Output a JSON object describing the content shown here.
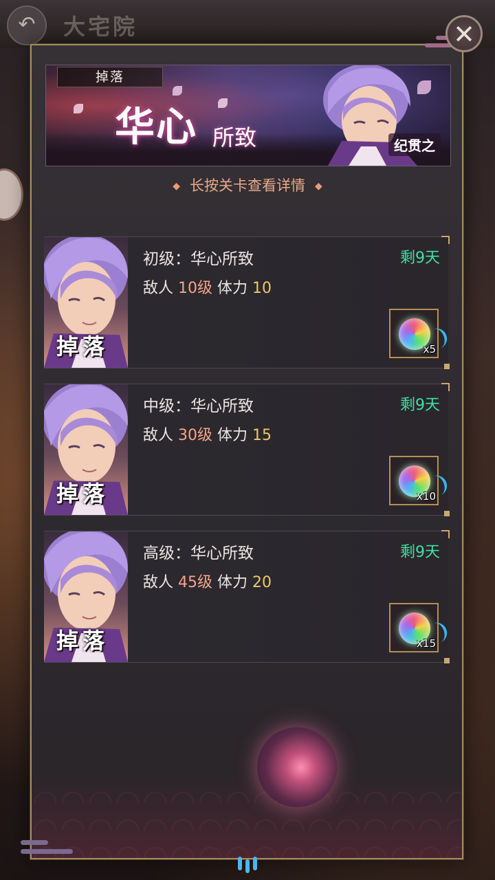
{
  "background": {
    "title": "大宅院"
  },
  "banner": {
    "drop_tag": "掉落",
    "title": "华心",
    "subtitle": "所致",
    "character_name": "纪贯之"
  },
  "hint": "长按关卡查看详情",
  "stages": [
    {
      "name": "初级：华心所致",
      "days_left": "剩9天",
      "enemy_label": "敌人",
      "enemy_level": "10级",
      "stamina_label": "体力",
      "stamina": "10",
      "portrait_tag": "掉落",
      "reward_count": "x5"
    },
    {
      "name": "中级：华心所致",
      "days_left": "剩9天",
      "enemy_label": "敌人",
      "enemy_level": "30级",
      "stamina_label": "体力",
      "stamina": "15",
      "portrait_tag": "掉落",
      "reward_count": "x10"
    },
    {
      "name": "高级：华心所致",
      "days_left": "剩9天",
      "enemy_label": "敌人",
      "enemy_level": "45级",
      "stamina_label": "体力",
      "stamina": "20",
      "portrait_tag": "掉落",
      "reward_count": "x15"
    }
  ],
  "icons": {
    "close": "close-icon",
    "back": "back-arrow-icon",
    "reward": "rainbow-orb-icon"
  },
  "colors": {
    "days_left": "#41e0a0",
    "enemy_level": "#f4a58a",
    "stamina": "#f0c76a",
    "hint": "#e8a88a",
    "panel_border": "#a88c5c"
  }
}
